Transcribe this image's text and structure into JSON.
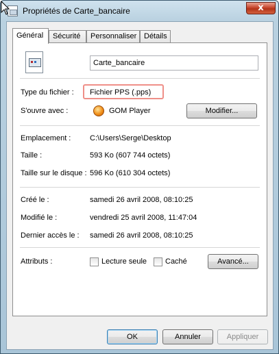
{
  "window": {
    "title": "Propriétés de Carte_bancaire",
    "close_label": "x"
  },
  "tabs": [
    {
      "label": "Général",
      "active": true
    },
    {
      "label": "Sécurité",
      "active": false
    },
    {
      "label": "Personnaliser",
      "active": false
    },
    {
      "label": "Détails",
      "active": false
    }
  ],
  "general": {
    "file_name": "Carte_bancaire",
    "file_type_label": "Type du fichier :",
    "file_type_value": "Fichier PPS (.pps)",
    "opens_with_label": "S'ouvre avec :",
    "opens_with_app": "GOM Player",
    "modify_button": "Modifier...",
    "location_label": "Emplacement :",
    "location_value": "C:\\Users\\Serge\\Desktop",
    "size_label": "Taille :",
    "size_value": "593 Ko (607 744 octets)",
    "size_on_disk_label": "Taille sur le disque :",
    "size_on_disk_value": "596 Ko (610 304 octets)",
    "created_label": "Créé le :",
    "created_value": "samedi 26 avril 2008, 08:10:25",
    "modified_label": "Modifié le :",
    "modified_value": "vendredi 25 avril 2008, 11:47:04",
    "accessed_label": "Dernier accès le :",
    "accessed_value": "samedi 26 avril 2008, 08:10:25",
    "attributes_label": "Attributs :",
    "readonly_label": "Lecture seule",
    "readonly_checked": false,
    "hidden_label": "Caché",
    "hidden_checked": false,
    "advanced_button": "Avancé..."
  },
  "footer": {
    "ok_button": "OK",
    "cancel_button": "Annuler",
    "apply_button": "Appliquer"
  },
  "colors": {
    "highlight_border": "#ef8f88",
    "close_button": "#c7462d",
    "title_bar": "#b9d1e0"
  },
  "icons": {
    "title": "document-icon",
    "file": "pps-file-icon",
    "app": "gom-player-icon",
    "close": "close-icon",
    "cursor": "mouse-pointer-icon"
  }
}
